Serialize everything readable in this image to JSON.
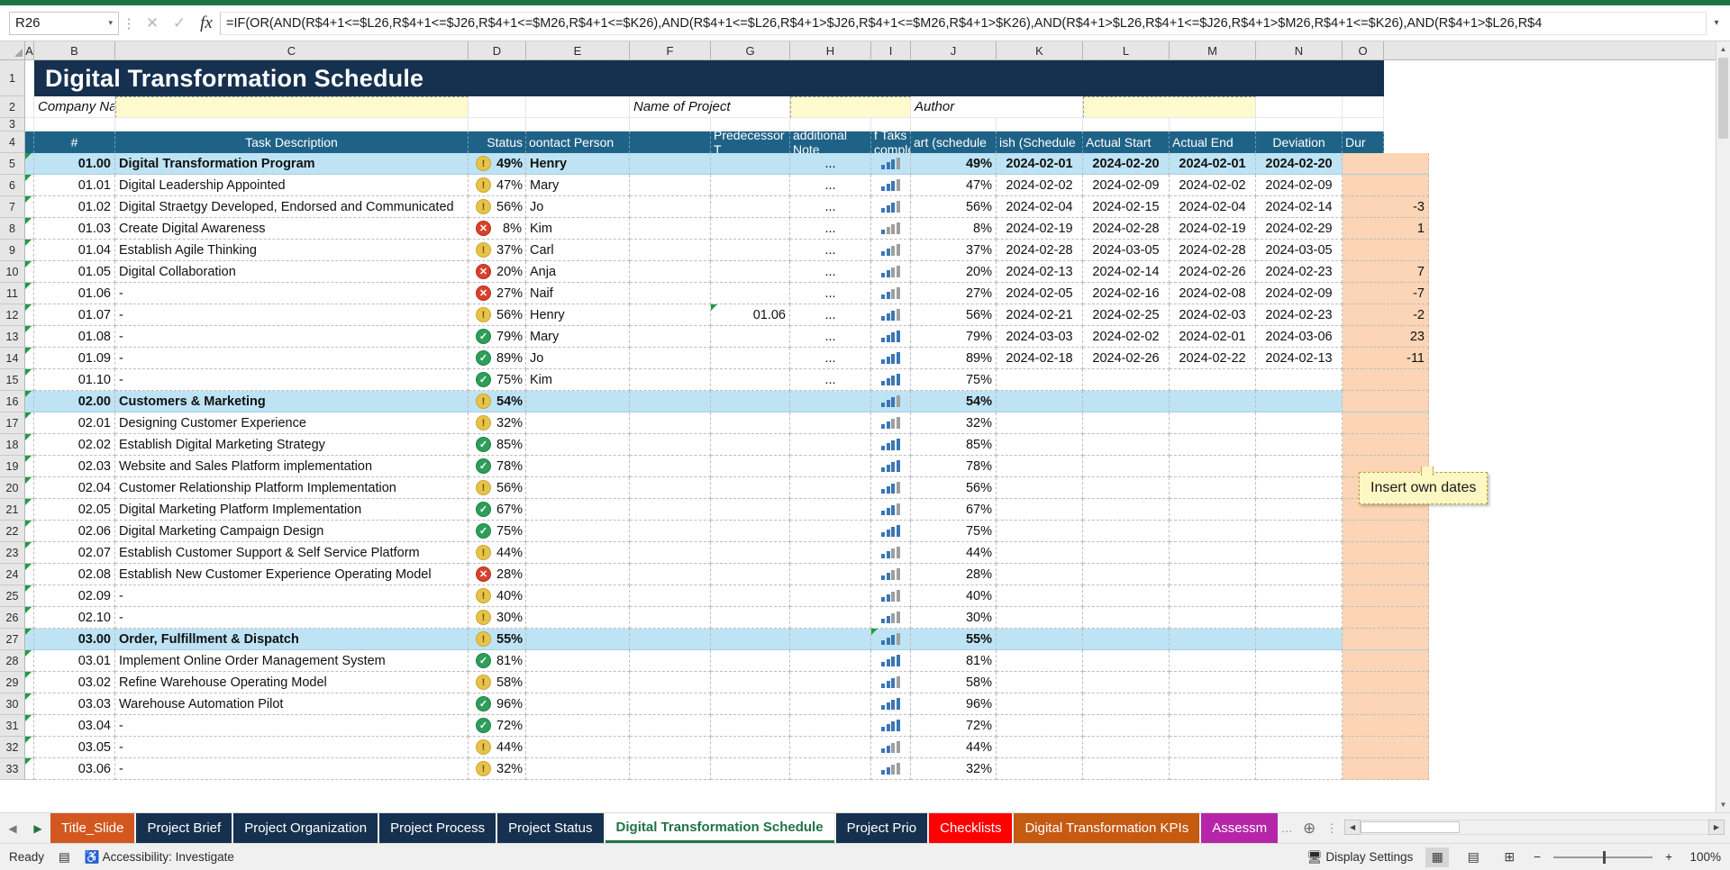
{
  "formula_bar": {
    "name_box": "R26",
    "formula": "=IF(OR(AND(R$4+1<=$L26,R$4+1<=$J26,R$4+1<=$M26,R$4+1<=$K26),AND(R$4+1<=$L26,R$4+1>$J26,R$4+1<=$M26,R$4+1>$K26),AND(R$4+1>$L26,R$4+1<=$J26,R$4+1>$M26,R$4+1<=$K26),AND(R$4+1>$L26,R$4",
    "cancel_icon": "✕",
    "confirm_icon": "✓",
    "fx_icon": "fx",
    "expand_icon": "▾",
    "dots_icon": "⋮"
  },
  "column_letters": [
    "A",
    "B",
    "C",
    "D",
    "E",
    "F",
    "G",
    "H",
    "I",
    "J",
    "K",
    "L",
    "M",
    "N",
    "O"
  ],
  "row_numbers": [
    "1",
    "2",
    "3",
    "4",
    "5",
    "6",
    "7",
    "8",
    "9",
    "10",
    "11",
    "12",
    "13",
    "14",
    "15",
    "16",
    "17",
    "18",
    "19",
    "20",
    "21",
    "22",
    "23",
    "24",
    "25",
    "26",
    "27",
    "28",
    "29",
    "30",
    "31",
    "32",
    "33"
  ],
  "sheet": {
    "title": "Digital Transformation Schedule",
    "labels": {
      "company_name": "Company Name",
      "name_of_project": "Name of Project",
      "author": "Author"
    },
    "headers": {
      "num": "#",
      "task_description": "Task Description",
      "status": "Status",
      "contact_person": "oontact Person",
      "predecessor": "Predecessor T",
      "additional_notes": "additional Note",
      "of_tasks_complete": "f Taks comple",
      "percent_complete": "",
      "start_scheduled": "art (schedule",
      "finish_scheduled": "ish (Schedule",
      "actual_start": "Actual Start",
      "actual_end": "Actual End",
      "deviation": "Deviation",
      "duration": "Dur"
    },
    "note": {
      "text": "Insert own dates"
    },
    "rows": [
      {
        "row": "5",
        "num": "01.00",
        "task": "Digital Transformation Program",
        "status": "warn",
        "pct": "49%",
        "person": "Henry",
        "pred": "",
        "notes": "...",
        "bars": 3,
        "pct2": "49%",
        "start": "2024-02-01",
        "finish": "2024-02-20",
        "astart": "2024-02-01",
        "aend": "2024-02-20",
        "dev": "",
        "group": true,
        "comment": true
      },
      {
        "row": "6",
        "num": "01.01",
        "task": "Digital Leadership Appointed",
        "status": "warn",
        "pct": "47%",
        "person": "Mary",
        "pred": "",
        "notes": "...",
        "bars": 3,
        "pct2": "47%",
        "start": "2024-02-02",
        "finish": "2024-02-09",
        "astart": "2024-02-02",
        "aend": "2024-02-09",
        "dev": "",
        "group": false,
        "comment": true
      },
      {
        "row": "7",
        "num": "01.02",
        "task": "Digital Straetgy Developed, Endorsed and Communicated",
        "status": "warn",
        "pct": "56%",
        "person": "Jo",
        "pred": "",
        "notes": "...",
        "bars": 3,
        "pct2": "56%",
        "start": "2024-02-04",
        "finish": "2024-02-15",
        "astart": "2024-02-04",
        "aend": "2024-02-14",
        "dev": "-3",
        "group": false,
        "comment": true
      },
      {
        "row": "8",
        "num": "01.03",
        "task": "Create Digital Awareness",
        "status": "bad",
        "pct": "8%",
        "person": "Kim",
        "pred": "",
        "notes": "...",
        "bars": 1,
        "pct2": "8%",
        "start": "2024-02-19",
        "finish": "2024-02-28",
        "astart": "2024-02-19",
        "aend": "2024-02-29",
        "dev": "1",
        "group": false,
        "comment": true
      },
      {
        "row": "9",
        "num": "01.04",
        "task": "Establish Agile Thinking",
        "status": "warn",
        "pct": "37%",
        "person": "Carl",
        "pred": "",
        "notes": "...",
        "bars": 2,
        "pct2": "37%",
        "start": "2024-02-28",
        "finish": "2024-03-05",
        "astart": "2024-02-28",
        "aend": "2024-03-05",
        "dev": "",
        "group": false,
        "comment": true
      },
      {
        "row": "10",
        "num": "01.05",
        "task": "Digital Collaboration",
        "status": "bad",
        "pct": "20%",
        "person": "Anja",
        "pred": "",
        "notes": "...",
        "bars": 2,
        "pct2": "20%",
        "start": "2024-02-13",
        "finish": "2024-02-14",
        "astart": "2024-02-26",
        "aend": "2024-02-23",
        "dev": "7",
        "group": false,
        "comment": true
      },
      {
        "row": "11",
        "num": "01.06",
        "task": "-",
        "status": "bad",
        "pct": "27%",
        "person": "Naif",
        "pred": "",
        "notes": "...",
        "bars": 2,
        "pct2": "27%",
        "start": "2024-02-05",
        "finish": "2024-02-16",
        "astart": "2024-02-08",
        "aend": "2024-02-09",
        "dev": "-7",
        "group": false,
        "comment": true
      },
      {
        "row": "12",
        "num": "01.07",
        "task": "-",
        "status": "warn",
        "pct": "56%",
        "person": "Henry",
        "pred": "01.06",
        "notes": "...",
        "bars": 3,
        "pct2": "56%",
        "start": "2024-02-21",
        "finish": "2024-02-25",
        "astart": "2024-02-03",
        "aend": "2024-02-23",
        "dev": "-2",
        "group": false,
        "comment": true,
        "pred_comment": true
      },
      {
        "row": "13",
        "num": "01.08",
        "task": "-",
        "status": "ok",
        "pct": "79%",
        "person": "Mary",
        "pred": "",
        "notes": "...",
        "bars": 4,
        "pct2": "79%",
        "start": "2024-03-03",
        "finish": "2024-02-02",
        "astart": "2024-02-01",
        "aend": "2024-03-06",
        "dev": "23",
        "group": false,
        "comment": true
      },
      {
        "row": "14",
        "num": "01.09",
        "task": "-",
        "status": "ok",
        "pct": "89%",
        "person": "Jo",
        "pred": "",
        "notes": "...",
        "bars": 4,
        "pct2": "89%",
        "start": "2024-02-18",
        "finish": "2024-02-26",
        "astart": "2024-02-22",
        "aend": "2024-02-13",
        "dev": "-11",
        "group": false,
        "comment": true
      },
      {
        "row": "15",
        "num": "01.10",
        "task": "-",
        "status": "ok",
        "pct": "75%",
        "person": "Kim",
        "pred": "",
        "notes": "...",
        "bars": 4,
        "pct2": "75%",
        "start": "",
        "finish": "",
        "astart": "",
        "aend": "",
        "dev": "",
        "group": false,
        "comment": true
      },
      {
        "row": "16",
        "num": "02.00",
        "task": "Customers & Marketing",
        "status": "warn",
        "pct": "54%",
        "person": "",
        "pred": "",
        "notes": "",
        "bars": 3,
        "pct2": "54%",
        "start": "",
        "finish": "",
        "astart": "",
        "aend": "",
        "dev": "",
        "group": true,
        "comment": true
      },
      {
        "row": "17",
        "num": "02.01",
        "task": "Designing Customer Experience",
        "status": "warn",
        "pct": "32%",
        "person": "",
        "pred": "",
        "notes": "",
        "bars": 2,
        "pct2": "32%",
        "start": "",
        "finish": "",
        "astart": "",
        "aend": "",
        "dev": "",
        "group": false,
        "comment": true
      },
      {
        "row": "18",
        "num": "02.02",
        "task": "Establish Digital Marketing Strategy",
        "status": "ok",
        "pct": "85%",
        "person": "",
        "pred": "",
        "notes": "",
        "bars": 4,
        "pct2": "85%",
        "start": "",
        "finish": "",
        "astart": "",
        "aend": "",
        "dev": "",
        "group": false,
        "comment": true
      },
      {
        "row": "19",
        "num": "02.03",
        "task": "Website and Sales Platform implementation",
        "status": "ok",
        "pct": "78%",
        "person": "",
        "pred": "",
        "notes": "",
        "bars": 4,
        "pct2": "78%",
        "start": "",
        "finish": "",
        "astart": "",
        "aend": "",
        "dev": "",
        "group": false,
        "comment": true
      },
      {
        "row": "20",
        "num": "02.04",
        "task": "Customer Relationship Platform Implementation",
        "status": "warn",
        "pct": "56%",
        "person": "",
        "pred": "",
        "notes": "",
        "bars": 3,
        "pct2": "56%",
        "start": "",
        "finish": "",
        "astart": "",
        "aend": "",
        "dev": "",
        "group": false,
        "comment": true
      },
      {
        "row": "21",
        "num": "02.05",
        "task": "Digital Marketing Platform Implementation",
        "status": "ok",
        "pct": "67%",
        "person": "",
        "pred": "",
        "notes": "",
        "bars": 3,
        "pct2": "67%",
        "start": "",
        "finish": "",
        "astart": "",
        "aend": "",
        "dev": "",
        "group": false,
        "comment": true
      },
      {
        "row": "22",
        "num": "02.06",
        "task": "Digital Marketing Campaign Design",
        "status": "ok",
        "pct": "75%",
        "person": "",
        "pred": "",
        "notes": "",
        "bars": 4,
        "pct2": "75%",
        "start": "",
        "finish": "",
        "astart": "",
        "aend": "",
        "dev": "",
        "group": false,
        "comment": true
      },
      {
        "row": "23",
        "num": "02.07",
        "task": "Establish Customer Support & Self Service Platform",
        "status": "warn",
        "pct": "44%",
        "person": "",
        "pred": "",
        "notes": "",
        "bars": 2,
        "pct2": "44%",
        "start": "",
        "finish": "",
        "astart": "",
        "aend": "",
        "dev": "",
        "group": false,
        "comment": true
      },
      {
        "row": "24",
        "num": "02.08",
        "task": "Establish New Customer Experience Operating Model",
        "status": "bad",
        "pct": "28%",
        "person": "",
        "pred": "",
        "notes": "",
        "bars": 2,
        "pct2": "28%",
        "start": "",
        "finish": "",
        "astart": "",
        "aend": "",
        "dev": "",
        "group": false,
        "comment": true
      },
      {
        "row": "25",
        "num": "02.09",
        "task": "-",
        "status": "warn",
        "pct": "40%",
        "person": "",
        "pred": "",
        "notes": "",
        "bars": 2,
        "pct2": "40%",
        "start": "",
        "finish": "",
        "astart": "",
        "aend": "",
        "dev": "",
        "group": false,
        "comment": true
      },
      {
        "row": "26",
        "num": "02.10",
        "task": "-",
        "status": "warn",
        "pct": "30%",
        "person": "",
        "pred": "",
        "notes": "",
        "bars": 2,
        "pct2": "30%",
        "start": "",
        "finish": "",
        "astart": "",
        "aend": "",
        "dev": "",
        "group": false,
        "comment": true
      },
      {
        "row": "27",
        "num": "03.00",
        "task": "Order, Fulfillment & Dispatch",
        "status": "warn",
        "pct": "55%",
        "person": "",
        "pred": "",
        "notes": "",
        "bars": 3,
        "pct2": "55%",
        "start": "",
        "finish": "",
        "astart": "",
        "aend": "",
        "dev": "",
        "group": true,
        "comment": true,
        "notes_comment": true
      },
      {
        "row": "28",
        "num": "03.01",
        "task": "Implement Online Order Management System",
        "status": "ok",
        "pct": "81%",
        "person": "",
        "pred": "",
        "notes": "",
        "bars": 4,
        "pct2": "81%",
        "start": "",
        "finish": "",
        "astart": "",
        "aend": "",
        "dev": "",
        "group": false,
        "comment": true
      },
      {
        "row": "29",
        "num": "03.02",
        "task": "Refine Warehouse Operating Model",
        "status": "warn",
        "pct": "58%",
        "person": "",
        "pred": "",
        "notes": "",
        "bars": 3,
        "pct2": "58%",
        "start": "",
        "finish": "",
        "astart": "",
        "aend": "",
        "dev": "",
        "group": false,
        "comment": true
      },
      {
        "row": "30",
        "num": "03.03",
        "task": "Warehouse Automation Pilot",
        "status": "ok",
        "pct": "96%",
        "person": "",
        "pred": "",
        "notes": "",
        "bars": 4,
        "pct2": "96%",
        "start": "",
        "finish": "",
        "astart": "",
        "aend": "",
        "dev": "",
        "group": false,
        "comment": true
      },
      {
        "row": "31",
        "num": "03.04",
        "task": "-",
        "status": "ok",
        "pct": "72%",
        "person": "",
        "pred": "",
        "notes": "",
        "bars": 4,
        "pct2": "72%",
        "start": "",
        "finish": "",
        "astart": "",
        "aend": "",
        "dev": "",
        "group": false,
        "comment": true
      },
      {
        "row": "32",
        "num": "03.05",
        "task": "-",
        "status": "warn",
        "pct": "44%",
        "person": "",
        "pred": "",
        "notes": "",
        "bars": 2,
        "pct2": "44%",
        "start": "",
        "finish": "",
        "astart": "",
        "aend": "",
        "dev": "",
        "group": false,
        "comment": true
      },
      {
        "row": "33",
        "num": "03.06",
        "task": "-",
        "status": "warn",
        "pct": "32%",
        "person": "",
        "pred": "",
        "notes": "",
        "bars": 2,
        "pct2": "32%",
        "start": "",
        "finish": "",
        "astart": "",
        "aend": "",
        "dev": "",
        "group": false,
        "comment": true
      }
    ]
  },
  "tabs": [
    {
      "label": "Title_Slide",
      "color": "#d2581f",
      "active": false
    },
    {
      "label": "Project Brief",
      "color": "#16314f",
      "active": false
    },
    {
      "label": "Project Organization",
      "color": "#16314f",
      "active": false
    },
    {
      "label": "Project Process",
      "color": "#16314f",
      "active": false
    },
    {
      "label": "Project Status",
      "color": "#16314f",
      "active": false
    },
    {
      "label": "Digital Transformation Schedule",
      "color": "#ffffff",
      "active": true
    },
    {
      "label": "Project Prio",
      "color": "#16314f",
      "active": false
    },
    {
      "label": "Checklists",
      "color": "#ff0000",
      "active": false
    },
    {
      "label": "Digital Transformation KPIs",
      "color": "#c55a11",
      "active": false
    },
    {
      "label": "Assessm",
      "color": "#b625a8",
      "active": false
    }
  ],
  "tab_controls": {
    "prev_icon": "◀",
    "next_icon": "▶",
    "overflow_icon": "…",
    "add_sheet_icon": "✛",
    "dots_icon": "⋮",
    "scroll_left_icon": "◀",
    "scroll_right_icon": "▶"
  },
  "status_bar": {
    "ready": "Ready",
    "record_macro_icon": "record-macro-icon",
    "accessibility": "Accessibility: Investigate",
    "display_settings": "Display Settings",
    "view_normal_icon": "▦",
    "view_pagelayout_icon": "▤",
    "view_pagebreak_icon": "⊞",
    "zoom_out": "−",
    "zoom_in": "+",
    "zoom_level": "100%"
  },
  "colors": {
    "excel_green": "#217346",
    "title_navy": "#16314f",
    "header_teal": "#1f6287",
    "group_row": "#bee3f4",
    "band_peach": "#fbd5b5",
    "band_blue": "#bdd7ee",
    "input_yellow": "#fffacd"
  }
}
